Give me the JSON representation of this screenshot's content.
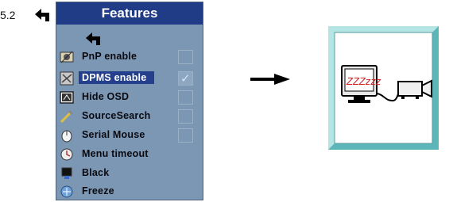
{
  "section_number": "5.2",
  "menu": {
    "title": "Features",
    "items": [
      {
        "label": "PnP enable",
        "icon": "pnp-icon",
        "checkbox": true,
        "checked": false,
        "selected": false
      },
      {
        "label": "DPMS enable",
        "icon": "dpms-icon",
        "checkbox": true,
        "checked": true,
        "selected": true
      },
      {
        "label": "Hide OSD",
        "icon": "hide-osd-icon",
        "checkbox": true,
        "checked": false,
        "selected": false
      },
      {
        "label": "SourceSearch",
        "icon": "source-search-icon",
        "checkbox": true,
        "checked": false,
        "selected": false
      },
      {
        "label": "Serial Mouse",
        "icon": "mouse-icon",
        "checkbox": true,
        "checked": false,
        "selected": false
      },
      {
        "label": "Menu timeout",
        "icon": "timeout-icon",
        "checkbox": false,
        "checked": false,
        "selected": false
      },
      {
        "label": "Black",
        "icon": "black-icon",
        "checkbox": false,
        "checked": false,
        "selected": false
      },
      {
        "label": "Freeze",
        "icon": "freeze-icon",
        "checkbox": false,
        "checked": false,
        "selected": false
      }
    ]
  },
  "standby_illustration": {
    "zzz_text": "ZZZzzz",
    "frame_color": "#7ecfd0",
    "inner_color": "#ffffff"
  },
  "colors": {
    "menu_bg": "#7c97b4",
    "header_bg": "#203c87",
    "selection_bg": "#243f8c"
  }
}
